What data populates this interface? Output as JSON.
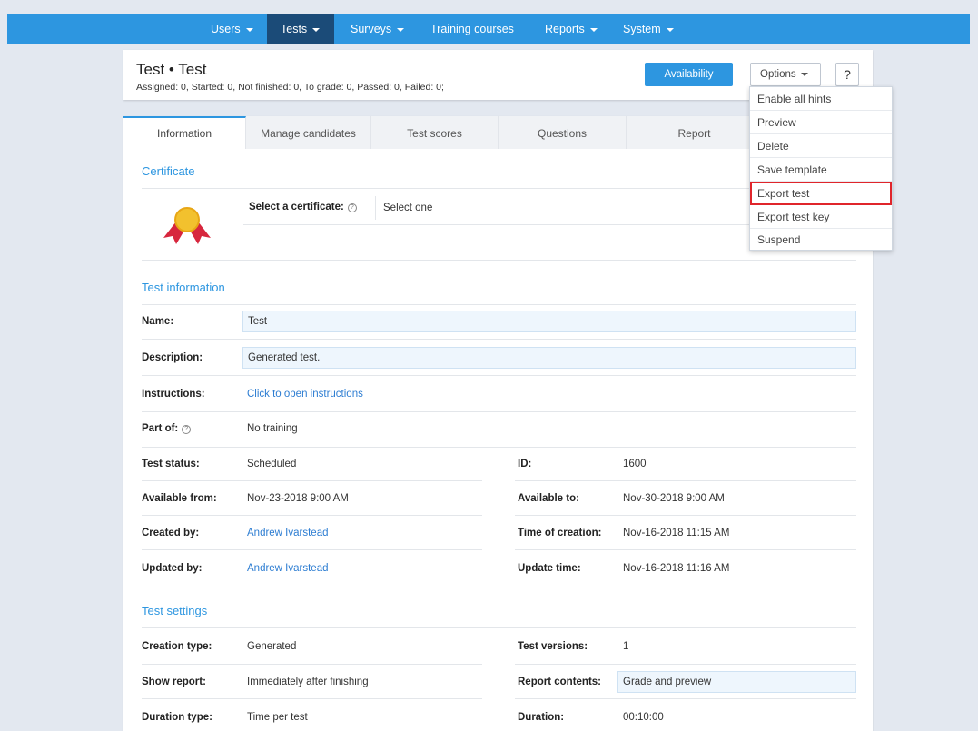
{
  "nav": {
    "items": [
      {
        "label": "Users",
        "caret": true
      },
      {
        "label": "Tests",
        "caret": true,
        "active": true
      },
      {
        "label": "Surveys",
        "caret": true
      },
      {
        "label": "Training courses",
        "caret": false
      },
      {
        "label": "Reports",
        "caret": true
      },
      {
        "label": "System",
        "caret": true
      }
    ]
  },
  "header": {
    "title": "Test • Test",
    "stats": "Assigned: 0, Started: 0, Not finished: 0, To grade: 0, Passed: 0, Failed: 0;",
    "availability_label": "Availability",
    "options_label": "Options",
    "help_label": "?"
  },
  "options_menu": {
    "items": [
      "Enable all hints",
      "Preview",
      "Delete",
      "Save template",
      "Export test",
      "Export test key",
      "Suspend"
    ],
    "highlighted": "Export test"
  },
  "tabs": [
    "Information",
    "Manage candidates",
    "Test scores",
    "Questions",
    "Report"
  ],
  "certificate": {
    "section_title": "Certificate",
    "select_label": "Select a certificate:",
    "select_value": "Select one"
  },
  "test_info": {
    "section_title": "Test information",
    "name_label": "Name:",
    "name_value": "Test",
    "description_label": "Description:",
    "description_value": "Generated test.",
    "instructions_label": "Instructions:",
    "instructions_value": "Click to open instructions",
    "part_of_label": "Part of:",
    "part_of_value": "No training",
    "status_label": "Test status:",
    "status_value": "Scheduled",
    "id_label": "ID:",
    "id_value": "1600",
    "available_from_label": "Available from:",
    "available_from_value": "Nov-23-2018 9:00 AM",
    "available_to_label": "Available to:",
    "available_to_value": "Nov-30-2018 9:00 AM",
    "created_by_label": "Created by:",
    "created_by_value": "Andrew Ivarstead",
    "time_of_creation_label": "Time of creation:",
    "time_of_creation_value": "Nov-16-2018 11:15 AM",
    "updated_by_label": "Updated by:",
    "updated_by_value": "Andrew Ivarstead",
    "update_time_label": "Update time:",
    "update_time_value": "Nov-16-2018 11:16 AM"
  },
  "test_settings": {
    "section_title": "Test settings",
    "creation_type_label": "Creation type:",
    "creation_type_value": "Generated",
    "test_versions_label": "Test versions:",
    "test_versions_value": "1",
    "show_report_label": "Show report:",
    "show_report_value": "Immediately after finishing",
    "report_contents_label": "Report contents:",
    "report_contents_value": "Grade and preview",
    "duration_type_label": "Duration type:",
    "duration_type_value": "Time per test",
    "duration_label": "Duration:",
    "duration_value": "00:10:00"
  },
  "colors": {
    "nav_bg": "#2d96e0",
    "nav_active": "#1b4b78",
    "accent": "#2d96e0",
    "field_bg": "#eef6fd",
    "highlight_border": "#e0252b",
    "page_bg": "#e3e8f0"
  },
  "icons": [
    "certificate-medal-icon",
    "help-circle-icon",
    "caret-down-icon"
  ]
}
